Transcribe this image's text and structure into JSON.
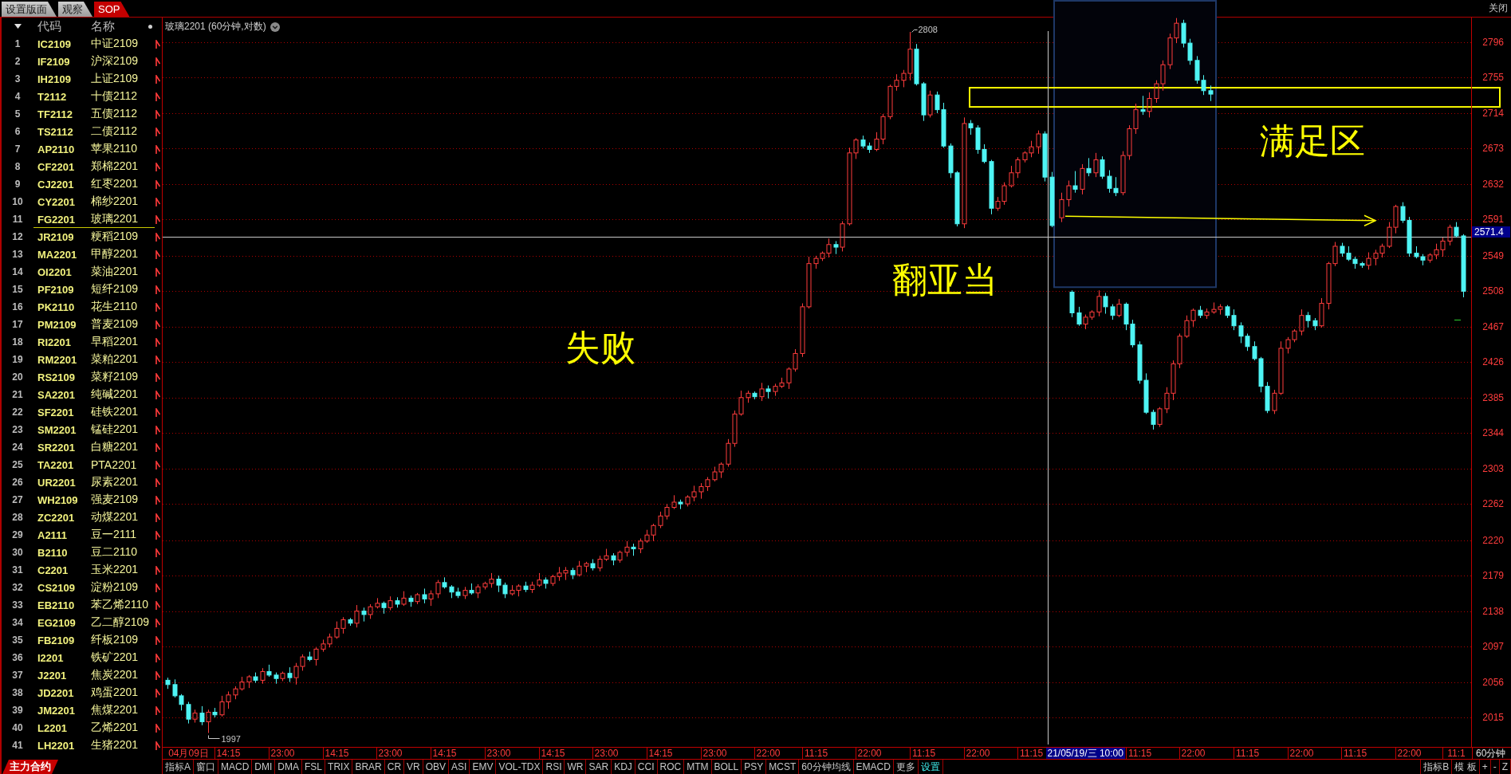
{
  "tabs": [
    {
      "label": "设置版面",
      "selected": false
    },
    {
      "label": "观察",
      "selected": false
    },
    {
      "label": "SOP",
      "selected": true
    }
  ],
  "close_button": "关闭",
  "watchlist": {
    "columns": [
      "代码",
      "名称"
    ],
    "rows": [
      {
        "number": "1",
        "code": "IC2109",
        "name": "中证2109",
        "selected": false
      },
      {
        "number": "2",
        "code": "IF2109",
        "name": "沪深2109",
        "selected": false
      },
      {
        "number": "3",
        "code": "IH2109",
        "name": "上证2109",
        "selected": false
      },
      {
        "number": "4",
        "code": "T2112",
        "name": "十债2112",
        "selected": false
      },
      {
        "number": "5",
        "code": "TF2112",
        "name": "五债2112",
        "selected": false
      },
      {
        "number": "6",
        "code": "TS2112",
        "name": "二债2112",
        "selected": false
      },
      {
        "number": "7",
        "code": "AP2110",
        "name": "苹果2110",
        "selected": false
      },
      {
        "number": "8",
        "code": "CF2201",
        "name": "郑棉2201",
        "selected": false
      },
      {
        "number": "9",
        "code": "CJ2201",
        "name": "红枣2201",
        "selected": false
      },
      {
        "number": "10",
        "code": "CY2201",
        "name": "棉纱2201",
        "selected": false
      },
      {
        "number": "11",
        "code": "FG2201",
        "name": "玻璃2201",
        "selected": true
      },
      {
        "number": "12",
        "code": "JR2109",
        "name": "粳稻2109",
        "selected": false
      },
      {
        "number": "13",
        "code": "MA2201",
        "name": "甲醇2201",
        "selected": false
      },
      {
        "number": "14",
        "code": "OI2201",
        "name": "菜油2201",
        "selected": false
      },
      {
        "number": "15",
        "code": "PF2109",
        "name": "短纤2109",
        "selected": false
      },
      {
        "number": "16",
        "code": "PK2110",
        "name": "花生2110",
        "selected": false
      },
      {
        "number": "17",
        "code": "PM2109",
        "name": "普麦2109",
        "selected": false
      },
      {
        "number": "18",
        "code": "RI2201",
        "name": "早稻2201",
        "selected": false
      },
      {
        "number": "19",
        "code": "RM2201",
        "name": "菜粕2201",
        "selected": false
      },
      {
        "number": "20",
        "code": "RS2109",
        "name": "菜籽2109",
        "selected": false
      },
      {
        "number": "21",
        "code": "SA2201",
        "name": "纯碱2201",
        "selected": false
      },
      {
        "number": "22",
        "code": "SF2201",
        "name": "硅铁2201",
        "selected": false
      },
      {
        "number": "23",
        "code": "SM2201",
        "name": "锰硅2201",
        "selected": false
      },
      {
        "number": "24",
        "code": "SR2201",
        "name": "白糖2201",
        "selected": false
      },
      {
        "number": "25",
        "code": "TA2201",
        "name": "PTA2201",
        "selected": false
      },
      {
        "number": "26",
        "code": "UR2201",
        "name": "尿素2201",
        "selected": false
      },
      {
        "number": "27",
        "code": "WH2109",
        "name": "强麦2109",
        "selected": false
      },
      {
        "number": "28",
        "code": "ZC2201",
        "name": "动煤2201",
        "selected": false
      },
      {
        "number": "29",
        "code": "A2111",
        "name": "豆一2111",
        "selected": false
      },
      {
        "number": "30",
        "code": "B2110",
        "name": "豆二2110",
        "selected": false
      },
      {
        "number": "31",
        "code": "C2201",
        "name": "玉米2201",
        "selected": false
      },
      {
        "number": "32",
        "code": "CS2109",
        "name": "淀粉2109",
        "selected": false
      },
      {
        "number": "33",
        "code": "EB2110",
        "name": "苯乙烯2110",
        "selected": false
      },
      {
        "number": "34",
        "code": "EG2109",
        "name": "乙二醇2109",
        "selected": false
      },
      {
        "number": "35",
        "code": "FB2109",
        "name": "纤板2109",
        "selected": false
      },
      {
        "number": "36",
        "code": "I2201",
        "name": "铁矿2201",
        "selected": false
      },
      {
        "number": "37",
        "code": "J2201",
        "name": "焦炭2201",
        "selected": false
      },
      {
        "number": "38",
        "code": "JD2201",
        "name": "鸡蛋2201",
        "selected": false
      },
      {
        "number": "39",
        "code": "JM2201",
        "name": "焦煤2201",
        "selected": false
      },
      {
        "number": "40",
        "code": "L2201",
        "name": "乙烯2201",
        "selected": false
      },
      {
        "number": "41",
        "code": "LH2201",
        "name": "生猪2201",
        "selected": false
      }
    ],
    "footer_tab": "主力合约"
  },
  "chart": {
    "title": "玻璃2201 (60分钟,对数)",
    "chart_data": {
      "type": "candlestick",
      "grid": true,
      "ylim": [
        1980.9,
        2824.6
      ],
      "yticks": [
        2796,
        2755,
        2714,
        2673,
        2632,
        2591,
        2549,
        2508,
        2467,
        2426,
        2385,
        2344,
        2303,
        2262,
        2220,
        2179,
        2138,
        2097,
        2056,
        2015
      ],
      "ref_lines": [
        {
          "axis": "y",
          "value": 2571.4,
          "label": "2571.4"
        }
      ],
      "categories": [
        null,
        null,
        null,
        null,
        null,
        null,
        "04月09日",
        null,
        null,
        null,
        null,
        null,
        null,
        null,
        null,
        null,
        null,
        null,
        "14:15",
        null,
        null,
        null,
        null,
        null,
        null,
        null,
        null,
        null,
        null,
        null,
        null,
        null,
        null,
        null,
        "23:00",
        null,
        null,
        null,
        null,
        null,
        null,
        null,
        null,
        null,
        null,
        null,
        null,
        null,
        null,
        null,
        "14:15",
        null,
        null,
        null,
        null,
        null,
        null,
        null,
        null,
        null,
        null,
        null,
        null,
        null,
        null,
        null,
        "23:00",
        null,
        null,
        null,
        null,
        null,
        null,
        null,
        null,
        null,
        null,
        null,
        null,
        null,
        null,
        null,
        "14:15",
        null,
        null,
        null,
        null,
        null,
        null,
        null,
        null,
        null,
        null,
        null,
        null,
        null,
        null,
        null,
        "23:00",
        null,
        null,
        null,
        null,
        null,
        null,
        null,
        null,
        null,
        null,
        null,
        null,
        null,
        null,
        null,
        "14:15",
        null,
        null,
        null,
        null,
        null,
        null,
        null,
        null,
        null,
        null,
        null,
        null,
        null,
        null,
        null,
        "23:00",
        null,
        null,
        null,
        null,
        null,
        null,
        null,
        null,
        null,
        null,
        null,
        null,
        null,
        null,
        null,
        "14:15",
        null,
        null,
        null,
        null,
        null,
        null,
        null,
        null,
        null,
        null,
        null,
        null,
        null,
        null,
        null,
        "23:00",
        null,
        null,
        null,
        null,
        null,
        null,
        null,
        null,
        null,
        null,
        null,
        null,
        null,
        null,
        null,
        "22:00",
        null,
        null,
        null,
        null,
        null,
        null,
        null,
        null,
        null,
        null,
        null,
        null,
        null,
        "11:15",
        null,
        null,
        null,
        null,
        null,
        null,
        null,
        null,
        null,
        null,
        null,
        null,
        null,
        null,
        null,
        "22:00",
        null,
        null,
        null,
        null,
        null,
        null,
        null,
        null,
        null,
        null,
        null,
        null,
        null,
        null,
        null,
        "11:15",
        null,
        null,
        null,
        null,
        null,
        null,
        null,
        null,
        null,
        null,
        null,
        null,
        null,
        null,
        null,
        "22:00",
        null,
        null,
        null,
        null,
        null,
        null,
        null,
        null,
        null,
        null,
        null,
        null,
        null,
        null,
        null,
        "11:15",
        null,
        null,
        null,
        null,
        null,
        null,
        null,
        null,
        null,
        null,
        null,
        null,
        null,
        null,
        null,
        null,
        null,
        null,
        null,
        null,
        null,
        null,
        null,
        null,
        null,
        null,
        null,
        null,
        null,
        null,
        null,
        "11:15",
        null,
        null,
        null,
        null,
        null,
        null,
        null,
        null,
        null,
        null,
        null,
        null,
        null,
        null,
        null,
        "22:00",
        null,
        null,
        null,
        null,
        null,
        null,
        null,
        null,
        null,
        null,
        null,
        null,
        null,
        null,
        null,
        "11:15",
        null,
        null,
        null,
        null,
        null,
        null,
        null,
        null,
        null,
        null,
        null,
        null,
        null,
        null,
        null,
        "22:00",
        null,
        null,
        null,
        null,
        null,
        null,
        null,
        null,
        null,
        null,
        null,
        null,
        null,
        null,
        null,
        "11:15",
        null,
        null,
        null,
        null,
        null,
        null,
        null,
        null,
        null,
        null,
        null,
        null,
        null,
        null,
        null,
        "22:00",
        null,
        null,
        null,
        null,
        null,
        null,
        null,
        null,
        null,
        null,
        null,
        null,
        null,
        "11:1",
        null,
        null,
        null
      ],
      "ohlc": [
        [
          2058,
          2061,
          2048,
          2053
        ],
        null,
        [
          2053,
          2059,
          2038,
          2040
        ],
        null,
        [
          2040,
          2042,
          2023,
          2030
        ],
        null,
        [
          2030,
          2033,
          2008,
          2013
        ],
        null,
        [
          2013,
          2024,
          2009,
          2020
        ],
        null,
        [
          2020,
          2028,
          2006,
          2010
        ],
        null,
        [
          2010,
          2024,
          1997,
          2021
        ],
        null,
        [
          2021,
          2026,
          2015,
          2018
        ],
        null,
        [
          2018,
          2040,
          2016,
          2033
        ],
        null,
        [
          2033,
          2045,
          2025,
          2041
        ],
        null,
        [
          2041,
          2051,
          2036,
          2048
        ],
        null,
        [
          2048,
          2062,
          2046,
          2056
        ],
        null,
        [
          2056,
          2064,
          2049,
          2062
        ],
        null,
        [
          2062,
          2067,
          2055,
          2058
        ],
        null,
        [
          2058,
          2072,
          2054,
          2068
        ],
        null,
        [
          2068,
          2076,
          2062,
          2064
        ],
        null,
        [
          2064,
          2067,
          2054,
          2060
        ],
        null,
        [
          2060,
          2068,
          2057,
          2066
        ],
        null,
        [
          2066,
          2073,
          2056,
          2061
        ],
        null,
        [
          2061,
          2078,
          2053,
          2074
        ],
        null,
        [
          2074,
          2088,
          2069,
          2085
        ],
        null,
        [
          2085,
          2091,
          2080,
          2082
        ],
        null,
        [
          2082,
          2096,
          2075,
          2094
        ],
        null,
        [
          2094,
          2105,
          2091,
          2100
        ],
        null,
        [
          2100,
          2112,
          2096,
          2108
        ],
        null,
        [
          2108,
          2126,
          2106,
          2118
        ],
        null,
        [
          2118,
          2131,
          2112,
          2128
        ],
        null,
        [
          2128,
          2130,
          2121,
          2124
        ],
        null,
        [
          2124,
          2145,
          2119,
          2138
        ],
        null,
        [
          2138,
          2142,
          2126,
          2134
        ],
        null,
        [
          2134,
          2146,
          2129,
          2143
        ],
        null,
        [
          2143,
          2153,
          2141,
          2147
        ],
        null,
        [
          2147,
          2149,
          2135,
          2142
        ],
        null,
        [
          2142,
          2155,
          2139,
          2150
        ],
        null,
        [
          2150,
          2154,
          2142,
          2146
        ],
        null,
        [
          2146,
          2161,
          2144,
          2153
        ],
        null,
        [
          2153,
          2156,
          2143,
          2149
        ],
        null,
        [
          2149,
          2159,
          2146,
          2157
        ],
        null,
        [
          2157,
          2164,
          2147,
          2152
        ],
        null,
        [
          2152,
          2162,
          2144,
          2158
        ],
        null,
        [
          2158,
          2174,
          2153,
          2171
        ],
        null,
        [
          2171,
          2177,
          2164,
          2166
        ],
        null,
        [
          2166,
          2168,
          2153,
          2160
        ],
        null,
        [
          2160,
          2165,
          2153,
          2156
        ],
        null,
        [
          2156,
          2166,
          2152,
          2162
        ],
        null,
        [
          2162,
          2170,
          2157,
          2159
        ],
        null,
        [
          2159,
          2169,
          2153,
          2166
        ],
        null,
        [
          2166,
          2172,
          2163,
          2170
        ],
        null,
        [
          2170,
          2182,
          2165,
          2175
        ],
        null,
        [
          2175,
          2179,
          2160,
          2168
        ],
        null,
        [
          2168,
          2171,
          2153,
          2158
        ],
        null,
        [
          2158,
          2168,
          2156,
          2162
        ],
        null,
        [
          2162,
          2169,
          2155,
          2167
        ],
        null,
        [
          2167,
          2172,
          2160,
          2163
        ],
        null,
        [
          2163,
          2172,
          2159,
          2168
        ],
        null,
        [
          2168,
          2182,
          2166,
          2174
        ],
        null,
        [
          2174,
          2177,
          2164,
          2170
        ],
        null,
        [
          2170,
          2180,
          2167,
          2178
        ],
        null,
        [
          2178,
          2189,
          2173,
          2182
        ],
        null,
        [
          2182,
          2189,
          2174,
          2185
        ],
        null,
        [
          2185,
          2188,
          2175,
          2180
        ],
        null,
        [
          2180,
          2196,
          2178,
          2190
        ],
        null,
        [
          2190,
          2195,
          2183,
          2193
        ],
        null,
        [
          2193,
          2198,
          2185,
          2188
        ],
        null,
        [
          2188,
          2202,
          2184,
          2198
        ],
        null,
        [
          2198,
          2210,
          2196,
          2202
        ],
        null,
        [
          2202,
          2205,
          2191,
          2197
        ],
        null,
        [
          2197,
          2208,
          2194,
          2206
        ],
        null,
        [
          2206,
          2219,
          2201,
          2212
        ],
        null,
        [
          2212,
          2216,
          2202,
          2210
        ],
        null,
        [
          2210,
          2222,
          2205,
          2219
        ],
        null,
        [
          2219,
          2232,
          2217,
          2226
        ],
        null,
        [
          2226,
          2239,
          2219,
          2237
        ],
        null,
        [
          2237,
          2253,
          2234,
          2248
        ],
        null,
        [
          2248,
          2262,
          2244,
          2258
        ],
        null,
        [
          2258,
          2272,
          2256,
          2264
        ],
        null,
        [
          2264,
          2267,
          2256,
          2262
        ],
        null,
        [
          2262,
          2272,
          2259,
          2270
        ],
        null,
        [
          2270,
          2283,
          2265,
          2276
        ],
        null,
        [
          2276,
          2286,
          2268,
          2282
        ],
        null,
        [
          2282,
          2293,
          2277,
          2290
        ],
        null,
        [
          2290,
          2305,
          2288,
          2299
        ],
        null,
        [
          2299,
          2310,
          2292,
          2308
        ],
        null,
        [
          2308,
          2337,
          2305,
          2332
        ],
        null,
        [
          2332,
          2370,
          2328,
          2366
        ],
        null,
        [
          2366,
          2393,
          2364,
          2385
        ],
        null,
        [
          2385,
          2393,
          2379,
          2390
        ],
        null,
        [
          2390,
          2392,
          2383,
          2386
        ],
        null,
        [
          2386,
          2402,
          2381,
          2395
        ],
        null,
        [
          2395,
          2399,
          2384,
          2392
        ],
        null,
        [
          2392,
          2401,
          2387,
          2398
        ],
        null,
        [
          2398,
          2408,
          2396,
          2402
        ],
        null,
        [
          2402,
          2420,
          2395,
          2418
        ],
        null,
        [
          2418,
          2441,
          2415,
          2436
        ],
        null,
        [
          2436,
          2494,
          2432,
          2490
        ],
        null,
        [
          2490,
          2548,
          2488,
          2540
        ],
        null,
        [
          2540,
          2549,
          2534,
          2546
        ],
        null,
        [
          2546,
          2554,
          2543,
          2552
        ],
        null,
        [
          2552,
          2569,
          2547,
          2562
        ],
        null,
        [
          2562,
          2566,
          2551,
          2559
        ],
        null,
        [
          2559,
          2589,
          2554,
          2586
        ],
        null,
        [
          2586,
          2674,
          2584,
          2668
        ],
        null,
        [
          2668,
          2685,
          2661,
          2683
        ],
        null,
        [
          2683,
          2688,
          2673,
          2676
        ],
        null,
        [
          2676,
          2680,
          2668,
          2672
        ],
        null,
        [
          2672,
          2692,
          2670,
          2684
        ],
        null,
        [
          2684,
          2713,
          2678,
          2710
        ],
        null,
        [
          2710,
          2747,
          2707,
          2745
        ],
        null,
        [
          2745,
          2759,
          2740,
          2752
        ],
        null,
        [
          2752,
          2764,
          2744,
          2760
        ],
        null,
        [
          2760,
          2808,
          2752,
          2788
        ],
        null,
        [
          2788,
          2794,
          2746,
          2748
        ],
        null,
        [
          2748,
          2750,
          2705,
          2712
        ],
        null,
        [
          2712,
          2740,
          2709,
          2735
        ],
        null,
        [
          2735,
          2739,
          2714,
          2718
        ],
        null,
        [
          2718,
          2726,
          2674,
          2676
        ],
        null,
        [
          2676,
          2679,
          2639,
          2645
        ],
        null,
        [
          2645,
          2647,
          2583,
          2586
        ],
        null,
        [
          2586,
          2709,
          2581,
          2702
        ],
        null,
        [
          2702,
          2706,
          2689,
          2697
        ],
        null,
        [
          2697,
          2700,
          2667,
          2672
        ],
        null,
        [
          2672,
          2678,
          2656,
          2658
        ],
        null,
        [
          2658,
          2660,
          2597,
          2604
        ],
        null,
        [
          2604,
          2617,
          2601,
          2612
        ],
        null,
        [
          2612,
          2634,
          2608,
          2630
        ],
        null,
        [
          2630,
          2653,
          2628,
          2645
        ],
        null,
        [
          2645,
          2663,
          2639,
          2660
        ],
        null,
        [
          2660,
          2670,
          2657,
          2668
        ],
        null,
        [
          2668,
          2682,
          2663,
          2675
        ],
        null,
        [
          2675,
          2694,
          2667,
          2690
        ],
        null,
        [
          2690,
          2693,
          2635,
          2640
        ],
        null,
        [
          2640,
          2646,
          2582,
          2584
        ],
        null,
        null,
        [
          2593,
          2622,
          2588,
          2614
        ],
        null,
        [
          2614,
          2636,
          2606,
          2630
        ],
        [
          2507,
          2509,
          2478,
          2483
        ],
        [
          2630,
          2647,
          2622,
          2626
        ],
        [
          2483,
          2490,
          2468,
          2470
        ],
        [
          2626,
          2655,
          2620,
          2650
        ],
        [
          2470,
          2481,
          2464,
          2478
        ],
        [
          2650,
          2662,
          2641,
          2645
        ],
        [
          2478,
          2486,
          2475,
          2484
        ],
        [
          2645,
          2668,
          2640,
          2660
        ],
        [
          2484,
          2509,
          2479,
          2502
        ],
        [
          2660,
          2664,
          2638,
          2641
        ],
        [
          2502,
          2506,
          2482,
          2490
        ],
        [
          2641,
          2648,
          2622,
          2627
        ],
        [
          2490,
          2493,
          2475,
          2480
        ],
        [
          2627,
          2640,
          2618,
          2622
        ],
        [
          2480,
          2499,
          2478,
          2493
        ],
        [
          2622,
          2670,
          2619,
          2665
        ],
        [
          2493,
          2495,
          2463,
          2470
        ],
        [
          2665,
          2700,
          2660,
          2696
        ],
        [
          2470,
          2475,
          2443,
          2446
        ],
        [
          2696,
          2725,
          2690,
          2718
        ],
        [
          2446,
          2450,
          2401,
          2405
        ],
        [
          2718,
          2734,
          2712,
          2716
        ],
        [
          2405,
          2413,
          2366,
          2368
        ],
        [
          2716,
          2738,
          2709,
          2731
        ],
        [
          2368,
          2371,
          2348,
          2354
        ],
        [
          2731,
          2752,
          2726,
          2748
        ],
        [
          2354,
          2374,
          2351,
          2372
        ],
        [
          2748,
          2775,
          2740,
          2770
        ],
        [
          2372,
          2397,
          2367,
          2390
        ],
        [
          2770,
          2806,
          2765,
          2801
        ],
        [
          2390,
          2428,
          2382,
          2424
        ],
        [
          2801,
          2824,
          2795,
          2818
        ],
        [
          2424,
          2459,
          2419,
          2456
        ],
        [
          2818,
          2822,
          2790,
          2795
        ],
        [
          2456,
          2480,
          2454,
          2474
        ],
        [
          2795,
          2800,
          2770,
          2775
        ],
        [
          2474,
          2488,
          2467,
          2486
        ],
        [
          2775,
          2780,
          2748,
          2752
        ],
        [
          2486,
          2491,
          2477,
          2480
        ],
        [
          2752,
          2758,
          2735,
          2740
        ],
        [
          2480,
          2488,
          2476,
          2484
        ],
        [
          2740,
          2746,
          2728,
          2736
        ],
        [
          2484,
          2495,
          2482,
          2487
        ],
        null,
        [
          2487,
          2493,
          2481,
          2490
        ],
        null,
        [
          2490,
          2492,
          2477,
          2480
        ],
        null,
        [
          2480,
          2487,
          2463,
          2468
        ],
        null,
        [
          2468,
          2472,
          2448,
          2456
        ],
        null,
        [
          2456,
          2459,
          2439,
          2444
        ],
        null,
        [
          2444,
          2450,
          2428,
          2430
        ],
        null,
        [
          2430,
          2432,
          2391,
          2398
        ],
        null,
        [
          2398,
          2403,
          2367,
          2370
        ],
        null,
        [
          2370,
          2394,
          2366,
          2390
        ],
        null,
        [
          2390,
          2450,
          2388,
          2442
        ],
        null,
        [
          2442,
          2455,
          2436,
          2452
        ],
        null,
        [
          2452,
          2464,
          2449,
          2462
        ],
        null,
        [
          2462,
          2487,
          2457,
          2480
        ],
        null,
        [
          2480,
          2484,
          2466,
          2474
        ],
        null,
        [
          2474,
          2477,
          2463,
          2468
        ],
        null,
        [
          2468,
          2500,
          2466,
          2494
        ],
        null,
        [
          2494,
          2542,
          2487,
          2540
        ],
        null,
        [
          2540,
          2565,
          2537,
          2560
        ],
        null,
        [
          2560,
          2564,
          2548,
          2552
        ],
        null,
        [
          2552,
          2560,
          2543,
          2545
        ],
        null,
        [
          2545,
          2548,
          2534,
          2540
        ],
        null,
        [
          2540,
          2542,
          2535,
          2538
        ],
        null,
        [
          2538,
          2553,
          2533,
          2546
        ],
        null,
        [
          2546,
          2556,
          2538,
          2552
        ],
        null,
        [
          2552,
          2563,
          2547,
          2560
        ],
        null,
        [
          2560,
          2588,
          2558,
          2582
        ],
        null,
        [
          2582,
          2608,
          2575,
          2606
        ],
        null,
        [
          2606,
          2611,
          2587,
          2590
        ],
        null,
        [
          2590,
          2594,
          2548,
          2552
        ],
        null,
        [
          2552,
          2560,
          2546,
          2548
        ],
        null,
        [
          2548,
          2551,
          2538,
          2544
        ],
        null,
        [
          2544,
          2552,
          2541,
          2550
        ],
        null,
        [
          2550,
          2563,
          2545,
          2556
        ],
        null,
        [
          2556,
          2570,
          2548,
          2566
        ],
        null,
        [
          2566,
          2585,
          2561,
          2582
        ],
        null,
        [
          2582,
          2588,
          2570,
          2572
        ],
        null,
        [
          2572,
          2574,
          2501,
          2508
        ],
        null
      ]
    },
    "high_label": "2808",
    "low_label": "1997",
    "annotations": [
      "满足区",
      "翻亚当",
      "失败"
    ],
    "cursor_label": "21/05/19/三 10:00",
    "period": "60分钟"
  },
  "toolbar": {
    "indicators": [
      {
        "label": "指标A",
        "highlighted": false
      },
      {
        "label": "窗口",
        "highlighted": false
      },
      {
        "label": "MACD",
        "highlighted": false
      },
      {
        "label": "DMI",
        "highlighted": false
      },
      {
        "label": "DMA",
        "highlighted": false
      },
      {
        "label": "FSL",
        "highlighted": false
      },
      {
        "label": "TRIX",
        "highlighted": false
      },
      {
        "label": "BRAR",
        "highlighted": false
      },
      {
        "label": "CR",
        "highlighted": false
      },
      {
        "label": "VR",
        "highlighted": false
      },
      {
        "label": "OBV",
        "highlighted": false
      },
      {
        "label": "ASI",
        "highlighted": false
      },
      {
        "label": "EMV",
        "highlighted": false
      },
      {
        "label": "VOL-TDX",
        "highlighted": false
      },
      {
        "label": "RSI",
        "highlighted": false
      },
      {
        "label": "WR",
        "highlighted": false
      },
      {
        "label": "SAR",
        "highlighted": false
      },
      {
        "label": "KDJ",
        "highlighted": false
      },
      {
        "label": "CCI",
        "highlighted": false
      },
      {
        "label": "ROC",
        "highlighted": false
      },
      {
        "label": "MTM",
        "highlighted": false
      },
      {
        "label": "BOLL",
        "highlighted": false
      },
      {
        "label": "PSY",
        "highlighted": false
      },
      {
        "label": "MCST",
        "highlighted": false
      },
      {
        "label": "60分钟均线",
        "highlighted": false
      },
      {
        "label": "EMACD",
        "highlighted": false
      },
      {
        "label": "更多",
        "highlighted": false
      },
      {
        "label": "设置",
        "highlighted": true
      }
    ],
    "tools": [
      "指标B",
      "模 板",
      "+",
      "-",
      "Z"
    ]
  }
}
